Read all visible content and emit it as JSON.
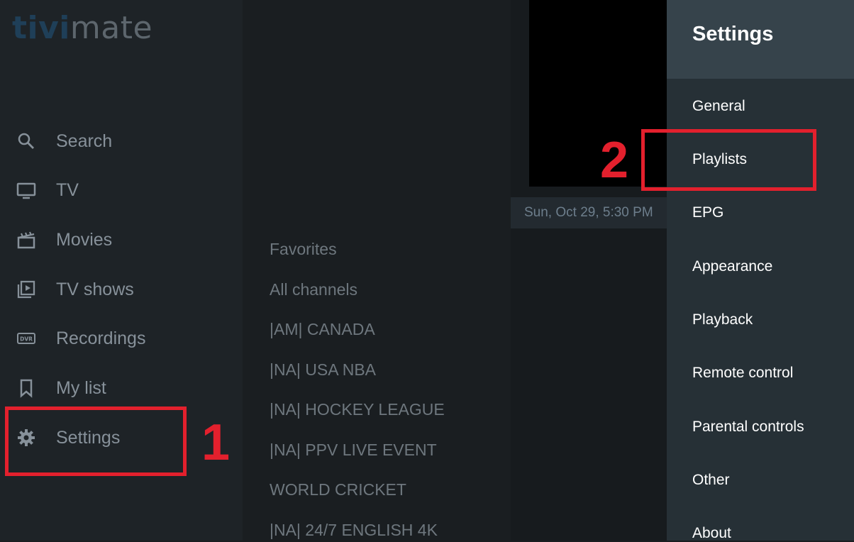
{
  "logo": {
    "part1": "tivi",
    "part2": "mate"
  },
  "nav": {
    "items": [
      {
        "label": "Search",
        "icon": "search-icon"
      },
      {
        "label": "TV",
        "icon": "tv-icon"
      },
      {
        "label": "Movies",
        "icon": "clapperboard-icon"
      },
      {
        "label": "TV shows",
        "icon": "play-library-icon"
      },
      {
        "label": "Recordings",
        "icon": "dvr-icon"
      },
      {
        "label": "My list",
        "icon": "bookmark-icon"
      },
      {
        "label": "Settings",
        "icon": "gear-icon"
      }
    ]
  },
  "categories": {
    "items": [
      "Favorites",
      "All channels",
      "|AM| CANADA",
      "|NA| USA NBA",
      "|NA| HOCKEY LEAGUE",
      "|NA| PPV LIVE EVENT",
      "WORLD CRICKET",
      "|NA| 24/7 ENGLISH 4K"
    ]
  },
  "content": {
    "datetime": "Sun, Oct 29, 5:30 PM"
  },
  "settings": {
    "title": "Settings",
    "items": [
      "General",
      "Playlists",
      "EPG",
      "Appearance",
      "Playback",
      "Remote control",
      "Parental controls",
      "Other",
      "About"
    ]
  },
  "annotations": {
    "step1": "1",
    "step2": "2",
    "color": "#e3202d"
  },
  "colors": {
    "panel_header": "#36434b",
    "settings_panel": "#263036",
    "sidebar": "#1e2327"
  }
}
